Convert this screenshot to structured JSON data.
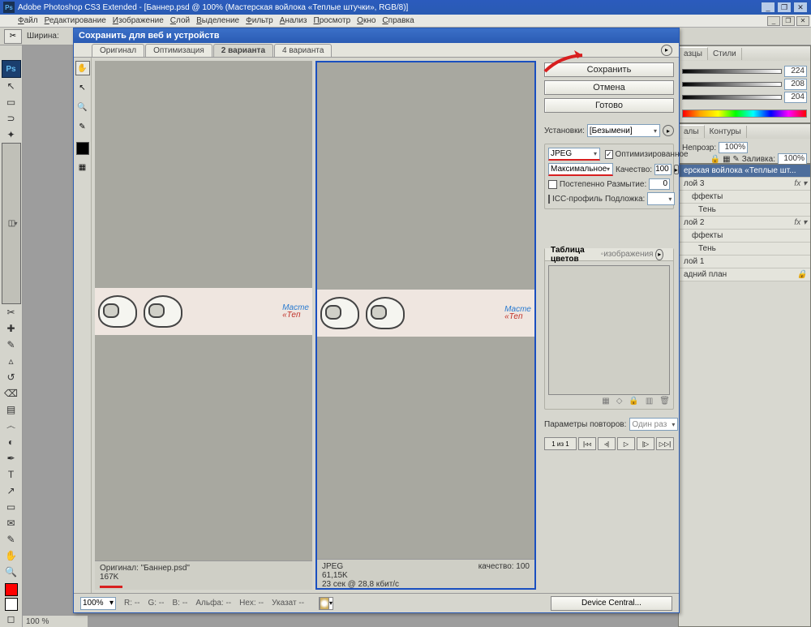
{
  "app": {
    "title": "Adobe Photoshop CS3 Extended - [Баннер.psd @ 100% (Мастерская войлока  «Теплые штучки», RGB/8)]"
  },
  "menu": [
    "Файл",
    "Редактирование",
    "Изображение",
    "Слой",
    "Выделение",
    "Фильтр",
    "Анализ",
    "Просмотр",
    "Окно",
    "Справка"
  ],
  "optbar": {
    "width_label": "Ширина:"
  },
  "dialog": {
    "title": "Сохранить для веб и устройств",
    "tabs": {
      "t1": "Оригинал",
      "t2": "Оптимизация",
      "t3": "2 варианта",
      "t4": "4 варианта"
    },
    "buttons": {
      "save": "Сохранить",
      "cancel": "Отмена",
      "done": "Готово"
    },
    "preset_label": "Установки:",
    "preset_value": "[Безымени]",
    "format": "JPEG",
    "quality_preset": "Максимальное",
    "optimized_label": "Оптимизированное",
    "quality_label": "Качество:",
    "quality_value": "100",
    "progressive_label": "Постепенно",
    "blur_label": "Размытие:",
    "blur_value": "0",
    "icc_label": "ICC-профиль",
    "matte_label": "Подложка:",
    "color_table_title": "Таблица цветов",
    "image_size_tab": "◦изображения",
    "repeat_label": "Параметры повторов:",
    "repeat_value": "Один раз",
    "frame_info": "1 из 1",
    "pane_original": {
      "line1": "Оригинал: \"Баннер.psd\"",
      "line2": "167K"
    },
    "pane_jpeg": {
      "line1": "JPEG",
      "line2": "61,15K",
      "line3": "23 сек @ 28,8 кбит/c",
      "q": "качество: 100"
    },
    "banner": {
      "l1": "Масте",
      "l2": "«Теп"
    },
    "footer": {
      "zoom": "100%",
      "r": "R:",
      "g": "G:",
      "b": "B:",
      "alpha": "Альфа:",
      "hex": "Hex:",
      "index": "Указат",
      "dash": "--",
      "device_central": "Device Central..."
    }
  },
  "right": {
    "swatches_tab": "азцы",
    "styles_tab": "Стили",
    "v1": "224",
    "v2": "208",
    "v3": "204",
    "channels_tab": "алы",
    "paths_tab": "Контуры",
    "opacity_label": "Непрозр:",
    "opacity": "100%",
    "fill_label": "Заливка:",
    "fill": "100%",
    "doc_title": "ерская войлока  «Теплые шт...",
    "layers": {
      "l3": "лой 3",
      "fx": "ффекты",
      "shadow": "Тень",
      "l2": "лой 2",
      "l1": "лой 1",
      "bg": "адний план"
    }
  },
  "status": {
    "zoom": "100 %"
  }
}
